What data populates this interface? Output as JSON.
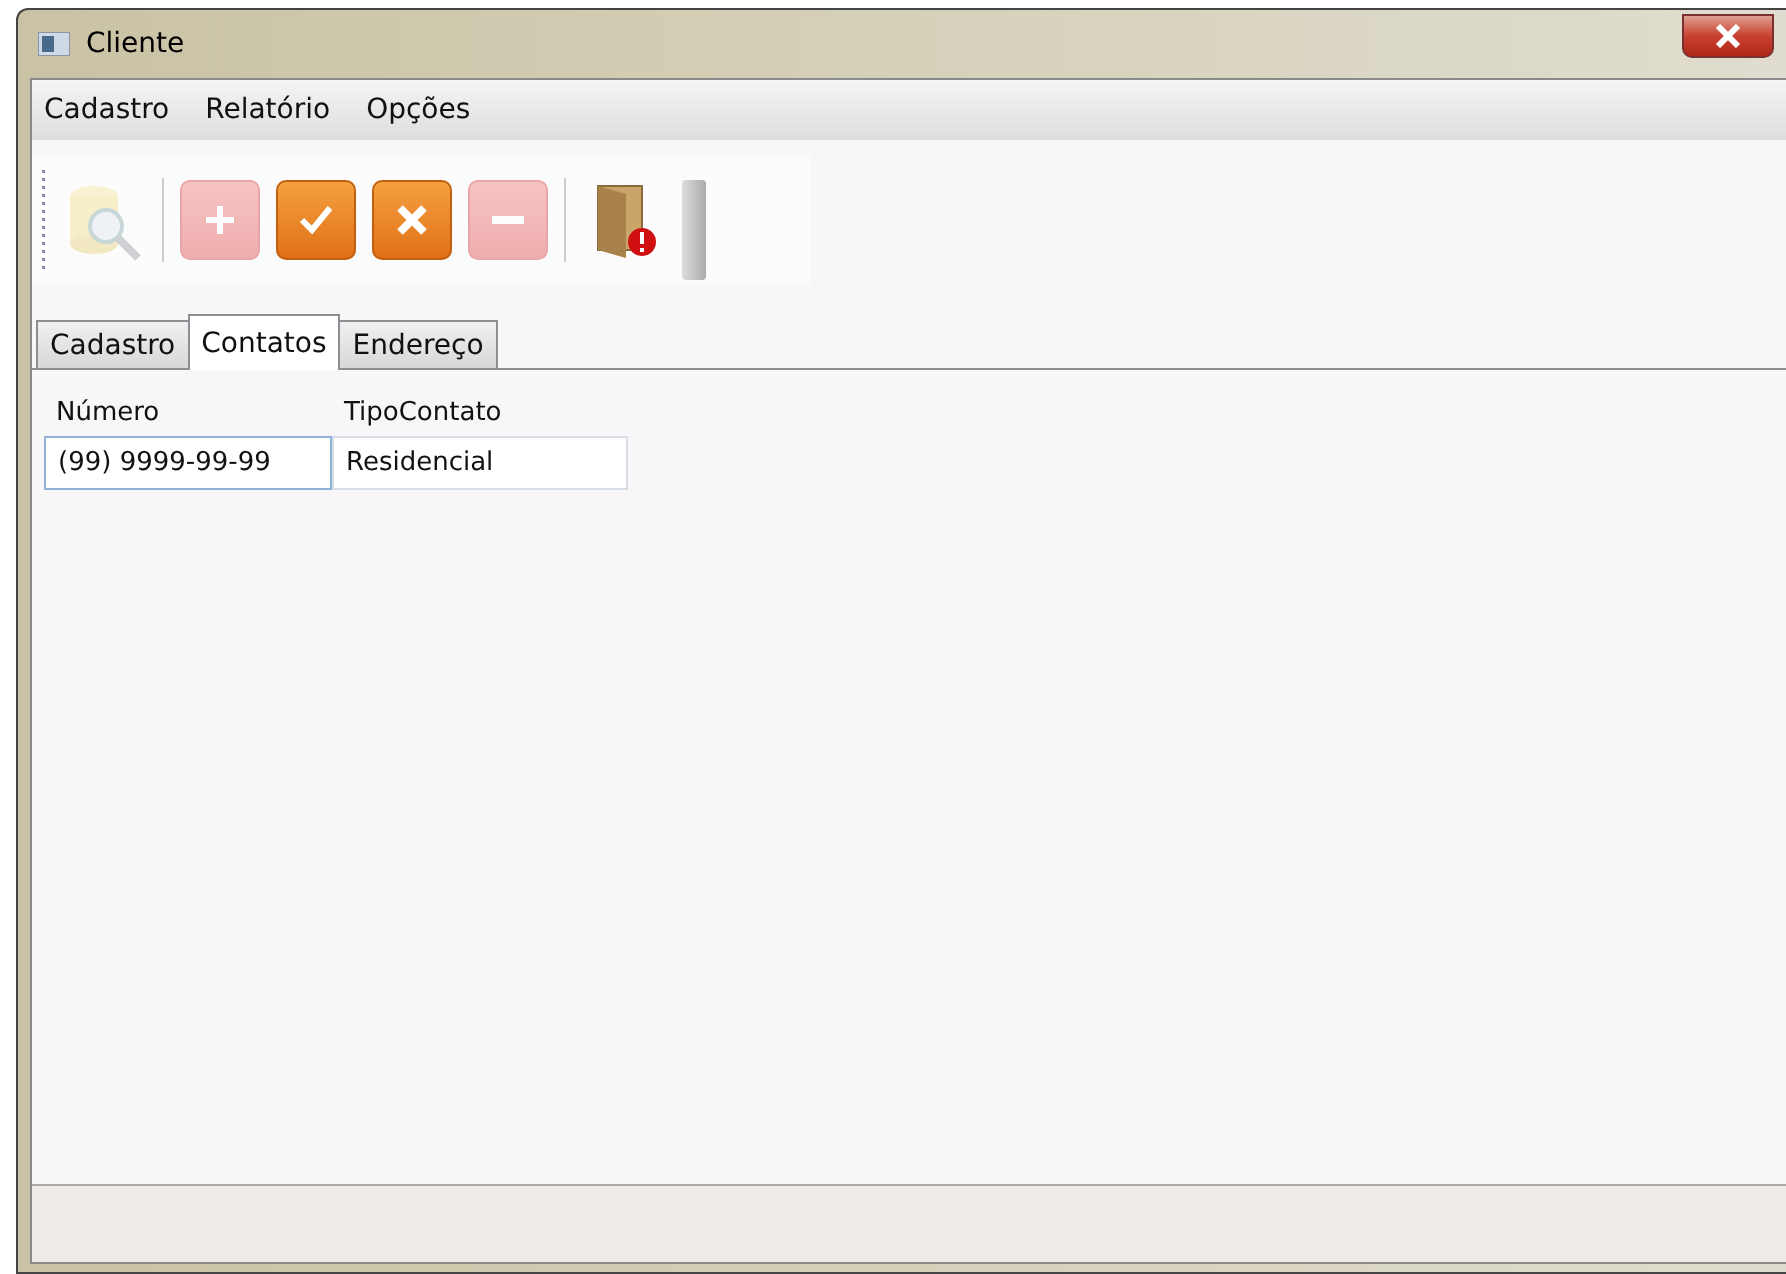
{
  "window": {
    "title": "Cliente"
  },
  "menu": [
    {
      "label": "Cadastro"
    },
    {
      "label": "Relatório"
    },
    {
      "label": "Opções"
    }
  ],
  "toolbar": [
    {
      "kind": "search",
      "disabled": true
    },
    {
      "kind": "add",
      "disabled": true
    },
    {
      "kind": "confirm",
      "disabled": false
    },
    {
      "kind": "cancel",
      "disabled": false
    },
    {
      "kind": "remove",
      "disabled": true
    },
    {
      "kind": "exit",
      "disabled": false
    }
  ],
  "tabs": [
    {
      "label": "Cadastro",
      "selected": false
    },
    {
      "label": "Contatos",
      "selected": true
    },
    {
      "label": "Endereço",
      "selected": false
    }
  ],
  "table": {
    "columns": [
      "Número",
      "TipoContato"
    ],
    "rows": [
      {
        "cells": [
          {
            "text": "(99) 9999-99-99",
            "focused": true
          },
          {
            "text": "Residencial",
            "focused": false
          }
        ]
      }
    ]
  }
}
